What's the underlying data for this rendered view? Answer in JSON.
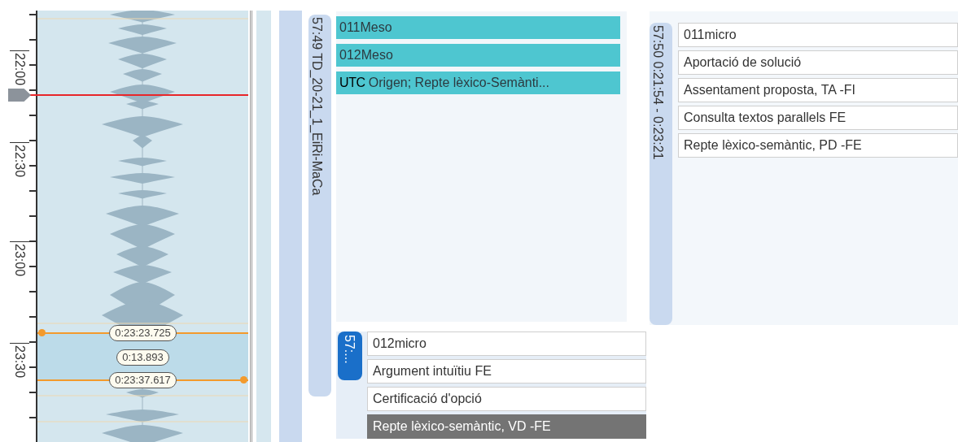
{
  "timeline": {
    "ruler_labels": [
      "22:00",
      "22:30",
      "23:00",
      "23:30"
    ],
    "selection": {
      "start": "0:23:23.725",
      "duration": "0:13.893",
      "end": "0:23:37.617"
    }
  },
  "groups": [
    {
      "label": "57:49 TD_20-21_1_EiRi-MaCa",
      "items": [
        {
          "kind": "meso",
          "text": "011Meso"
        },
        {
          "kind": "meso",
          "text": "012Meso"
        },
        {
          "kind": "meso",
          "prefix": "UTC",
          "text": "Origen; Repte lèxico-Semànti..."
        }
      ],
      "subgroup": {
        "label": "57:...",
        "items": [
          {
            "kind": "micro",
            "text": "012micro",
            "selected": false
          },
          {
            "kind": "micro",
            "text": "Argument intuïtiu FE",
            "selected": false
          },
          {
            "kind": "micro",
            "text": "Certificació d'opció",
            "selected": false
          },
          {
            "kind": "micro",
            "text": "Repte lèxico-semàntic, VD -FE",
            "selected": true
          }
        ]
      }
    },
    {
      "label": "57:50 0:21:54 - 0:23:21",
      "items": [
        {
          "kind": "micro",
          "text": "011micro",
          "selected": false
        },
        {
          "kind": "micro",
          "text": "Aportació de solució",
          "selected": false
        },
        {
          "kind": "micro",
          "text": "Assentament proposta, TA -FI",
          "selected": false
        },
        {
          "kind": "micro",
          "text": "Consulta textos parallels FE",
          "selected": false
        },
        {
          "kind": "micro",
          "text": "Repte lèxico-semàntic, PD -FE",
          "selected": false
        }
      ]
    }
  ]
}
